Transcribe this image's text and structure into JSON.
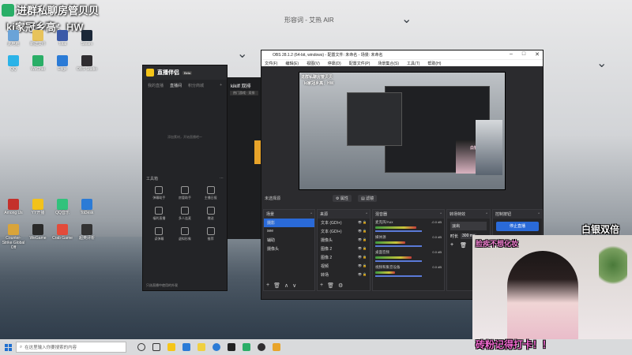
{
  "window_title": "形容词 - 艾热 AIR",
  "watermark": {
    "line1": "进群私聊房管贝贝",
    "line2": "ki家冠乡高：HW"
  },
  "desktop_icons": [
    {
      "label": "此电脑",
      "color": "#6aa3d8"
    },
    {
      "label": "新建文件",
      "color": "#e7c35b"
    },
    {
      "label": "Total",
      "color": "#3b5aa8"
    },
    {
      "label": "Steam",
      "color": "#1b2838"
    },
    {
      "label": "QQ",
      "color": "#2bb3e8"
    },
    {
      "label": "WeChat",
      "color": "#2aae67"
    },
    {
      "label": "Edge",
      "color": "#2b7bd6"
    },
    {
      "label": "OBS Studio",
      "color": "#302e31"
    },
    {
      "label": "Among Us",
      "color": "#c4302b"
    },
    {
      "label": "YY开播",
      "color": "#f2c21b"
    },
    {
      "label": "QQ音乐",
      "color": "#31c27c"
    },
    {
      "label": "ToDesk",
      "color": "#2b7bd6"
    },
    {
      "label": "Counter-Strike Global Off",
      "color": "#d9a43a"
    },
    {
      "label": "WeGame",
      "color": "#2a2a2a"
    },
    {
      "label": "Crab Game",
      "color": "#e34b3a"
    },
    {
      "label": "超英评析",
      "color": "#333"
    }
  ],
  "assistant": {
    "title": "直播伴侣",
    "badge": "Beta",
    "tabs": [
      "我的直播",
      "直播间",
      "积分商城"
    ],
    "empty_text": "添加素材，开始直播吧～",
    "tools_title": "工具箱",
    "tools": [
      "弹幕助手",
      "房管助手",
      "主播日报",
      "福利直播",
      "多人连麦",
      "赠送",
      "读弹幕",
      "虚拟形象",
      "推荐"
    ],
    "footer": "只选直播中使用的外观"
  },
  "kiki": {
    "title": "kikiff 双排",
    "subtitle": "热门游戏 · 双排"
  },
  "obs": {
    "title": "OBS 28.1.2 (64-bit, windows) - 配置文件: 未命名 - 场景: 未命名",
    "menu": [
      "文件(F)",
      "编辑(E)",
      "视图(V)",
      "停靠(D)",
      "配置文件(P)",
      "场景集合(S)",
      "工具(T)",
      "帮助(H)"
    ],
    "no_source": "未选择源",
    "props_btn": "属性",
    "filters_btn": "滤镜",
    "scenes_title": "场景",
    "scenes": [
      "摄影",
      "see",
      "辅助",
      "摄像头"
    ],
    "sources_title": "来源",
    "sources": [
      "文本 (GDI+)",
      "文本 (GDI+)",
      "摄像头",
      "图像 2",
      "图像 2",
      "视频",
      "转场"
    ],
    "mixer_title": "混音器",
    "mixer": [
      {
        "name": "麦克风/Aux",
        "value": "-0.0 dB",
        "level": 0.62
      },
      {
        "name": "媒体源",
        "value": "0.0 dB",
        "level": 0.45
      },
      {
        "name": "桌面音频",
        "value": "0.0 dB",
        "level": 0.55
      },
      {
        "name": "视频和集音设备",
        "value": "0.0 dB",
        "level": 0.3
      }
    ],
    "transitions_title": "转场特效",
    "transition_type": "淡出",
    "duration_label": "时长",
    "duration": "300 ms",
    "controls_title": "控制按钮",
    "stop_btn": "停止直播",
    "status_live": "LIVE: 00:00:00",
    "status_rec": "REC: 00:00:00"
  },
  "overlays": {
    "top_right": "白银双倍",
    "beauty": "脸疾不想化妆",
    "bottom": "砖粉记得打卡！！",
    "mini_text": "白银双倍"
  },
  "taskbar": {
    "search_placeholder": "在这里输入你要搜索的内容"
  }
}
